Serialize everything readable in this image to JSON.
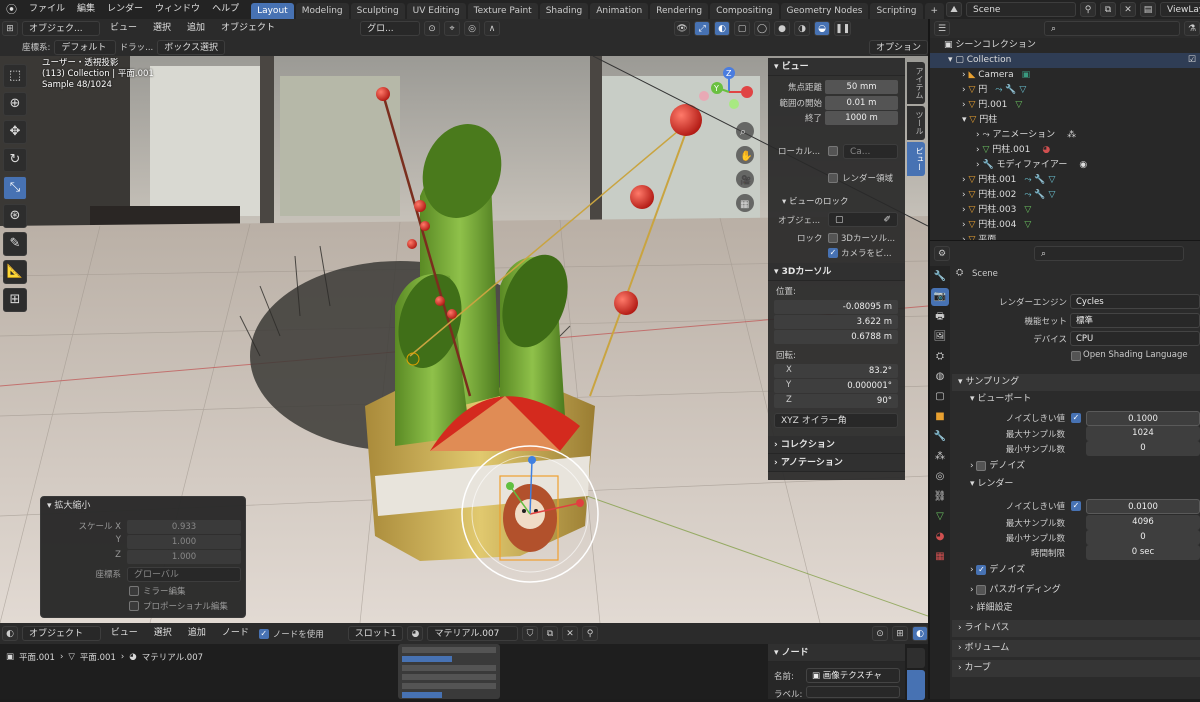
{
  "topbar": {
    "menus": [
      "ファイル",
      "編集",
      "レンダー",
      "ウィンドウ",
      "ヘルプ"
    ],
    "workspaces": [
      "Layout",
      "Modeling",
      "Sculpting",
      "UV Editing",
      "Texture Paint",
      "Shading",
      "Animation",
      "Rendering",
      "Compositing",
      "Geometry Nodes",
      "Scripting"
    ],
    "active_workspace": "Layout",
    "add_tab": "+",
    "scene": "Scene",
    "viewlayer": "ViewLayer"
  },
  "viewport_header": {
    "mode": "オブジェク...",
    "menus": [
      "ビュー",
      "選択",
      "追加",
      "オブジェクト"
    ],
    "transform": "グロ...",
    "coord_label": "座標系:",
    "coord_value": "デフォルト",
    "drag_label": "ドラッ...",
    "drag_value": "ボックス選択",
    "options": "オプション"
  },
  "viewport_overlay": {
    "line1": "ユーザー・透視投影",
    "line2": "(113) Collection | 平面.001",
    "line3": "Sample 48/1024"
  },
  "gizmo": {
    "z": "Z",
    "y": "Y",
    "x": "X"
  },
  "npanel": {
    "view_title": "ビュー",
    "focal_label": "焦点距離",
    "focal_value": "50 mm",
    "clip_start_label": "範囲の開始",
    "clip_start_value": "0.01 m",
    "clip_end_label": "終了",
    "clip_end_value": "1000 m",
    "local_label": "ローカル...",
    "local_value": "Ca...",
    "render_region": "レンダー領域",
    "viewlock_title": "ビューのロック",
    "lock_obj_label": "オブジェ...",
    "lock_label": "ロック",
    "lock_cursor": "3Dカーソル...",
    "lock_camera": "カメラをビ...",
    "cursor_title": "3Dカーソル",
    "location_label": "位置:",
    "loc_x": "-0.08095 m",
    "loc_y": "3.622 m",
    "loc_z": "0.6788 m",
    "rotation_label": "回転:",
    "rot_x": "83.2°",
    "rot_y": "0.000001°",
    "rot_z": "90°",
    "euler": "XYZ オイラー角",
    "collection": "コレクション",
    "annotation": "アノテーション",
    "tab_item": "アイテム",
    "tab_tool": "ツール",
    "tab_view": "ビュー",
    "x": "X",
    "y": "Y",
    "z": "Z"
  },
  "operator_panel": {
    "title": "拡大縮小",
    "scale_x_label": "スケール X",
    "scale_x": "0.933",
    "y_label": "Y",
    "scale_y": "1.000",
    "z_label": "Z",
    "scale_z": "1.000",
    "orient_label": "座標系",
    "orient_value": "グローバル",
    "mirror": "ミラー編集",
    "proportional": "プロポーショナル編集"
  },
  "outliner": {
    "search_placeholder": "",
    "rows": [
      {
        "label": "シーンコレクション",
        "indent": 0
      },
      {
        "label": "Collection",
        "indent": 1
      },
      {
        "label": "Camera",
        "indent": 2
      },
      {
        "label": "円",
        "indent": 2
      },
      {
        "label": "円.001",
        "indent": 2
      },
      {
        "label": "円柱",
        "indent": 2
      },
      {
        "label": "アニメーション",
        "indent": 3
      },
      {
        "label": "円柱.001",
        "indent": 3
      },
      {
        "label": "モディファイアー",
        "indent": 3
      },
      {
        "label": "円柱.001",
        "indent": 2
      },
      {
        "label": "円柱.002",
        "indent": 2
      },
      {
        "label": "円柱.003",
        "indent": 2
      },
      {
        "label": "円柱.004",
        "indent": 2
      },
      {
        "label": "平面",
        "indent": 2
      }
    ]
  },
  "properties": {
    "scene_label": "Scene",
    "engine_label": "レンダーエンジン",
    "engine_value": "Cycles",
    "feature_label": "機能セット",
    "feature_value": "標準",
    "device_label": "デバイス",
    "device_value": "CPU",
    "osl": "Open Shading Language",
    "sampling": "サンプリング",
    "viewport": "ビューポート",
    "noise_label": "ノイズしきい値",
    "vp_noise": "0.1000",
    "max_samples_label": "最大サンプル数",
    "vp_max": "1024",
    "min_samples_label": "最小サンプル数",
    "vp_min": "0",
    "denoise": "デノイズ",
    "render": "レンダー",
    "r_noise": "0.0100",
    "r_max": "4096",
    "r_min": "0",
    "time_label": "時間制限",
    "r_time": "0 sec",
    "path_guiding": "パスガイディング",
    "advanced": "詳細設定",
    "light_paths": "ライトパス",
    "volumes": "ボリューム",
    "curves": "カーブ"
  },
  "node_editor": {
    "mode": "オブジェクト",
    "menus": [
      "ビュー",
      "選択",
      "追加",
      "ノード"
    ],
    "use_nodes": "ノードを使用",
    "slot": "スロット1",
    "material": "マテリアル.007",
    "crumb1": "平面.001",
    "crumb2": "平面.001",
    "crumb3": "マテリアル.007",
    "panel_title": "ノード",
    "name_label": "名前:",
    "name_value": "画像テクスチャ",
    "label_label": "ラベル:"
  },
  "colors": {
    "accent": "#4772b3",
    "bg": "#1d1d1d",
    "panel": "#2b2b2b",
    "ornament_red": "#d42a1e",
    "bamboo": "#6a9e2c",
    "gold": "#c9a440"
  }
}
